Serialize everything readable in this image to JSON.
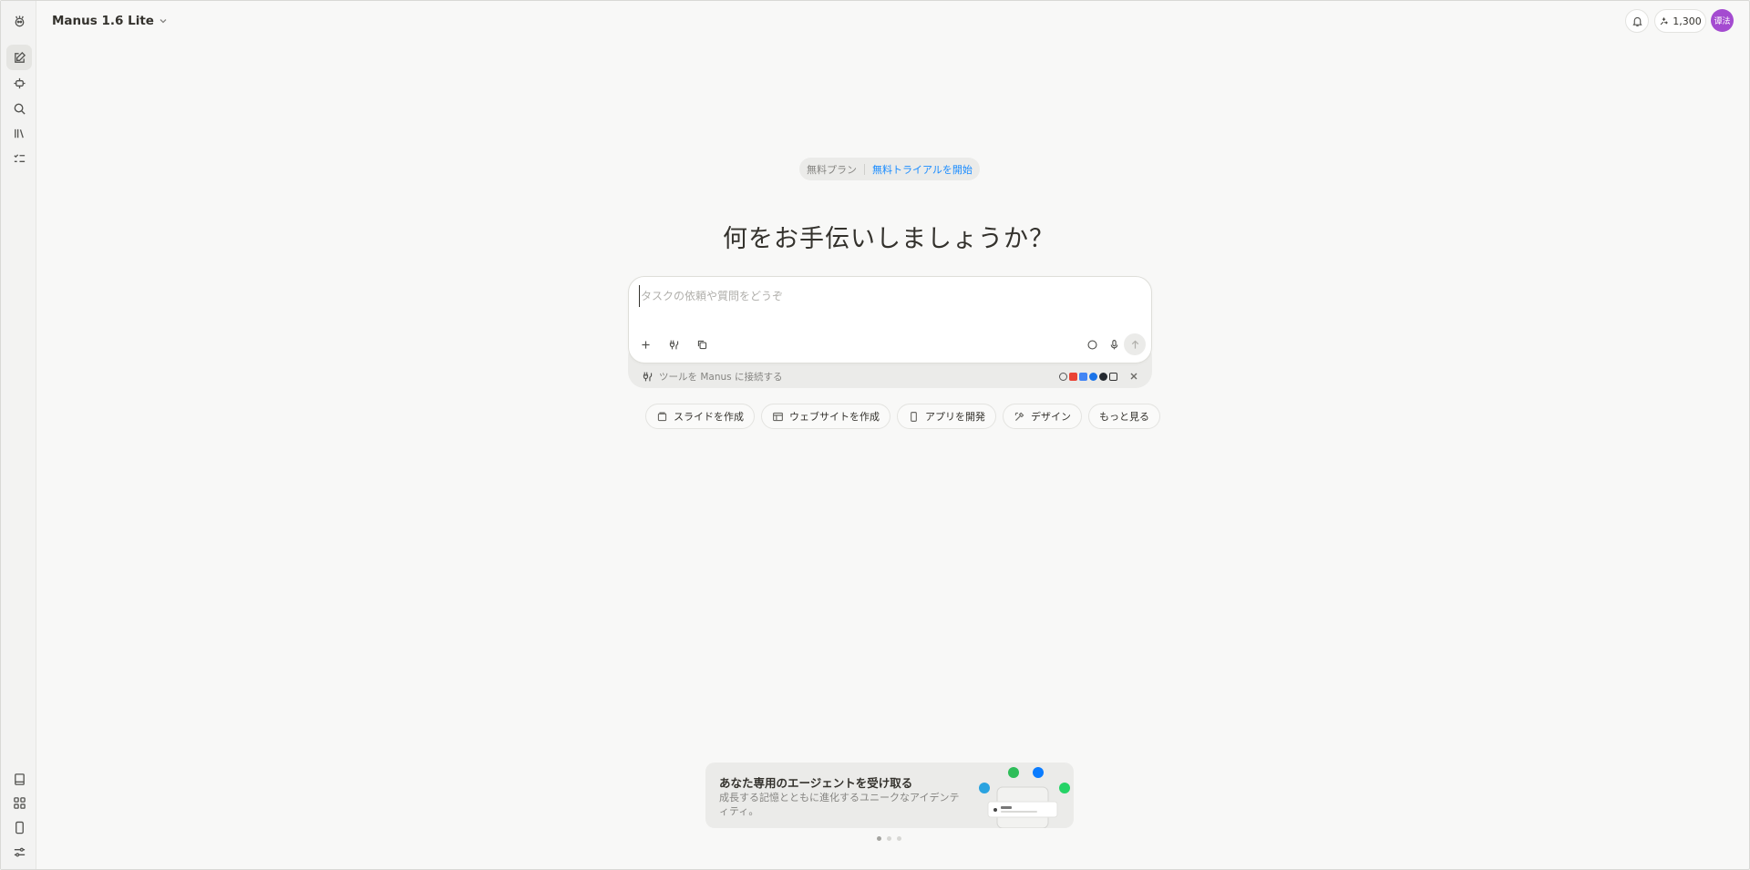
{
  "header": {
    "model_label": "Manus 1.6 Lite",
    "credits": "1,300",
    "avatar_initials": "谭法"
  },
  "sidebar": {
    "top_items": [
      {
        "name": "new-task",
        "icon": "edit-icon"
      },
      {
        "name": "agents",
        "icon": "agent-icon"
      },
      {
        "name": "search",
        "icon": "search-icon"
      },
      {
        "name": "library",
        "icon": "library-icon"
      },
      {
        "name": "tasks",
        "icon": "checklist-icon"
      }
    ],
    "bottom_items": [
      {
        "name": "docs",
        "icon": "book-icon"
      },
      {
        "name": "apps",
        "icon": "grid-icon"
      },
      {
        "name": "mobile",
        "icon": "phone-icon"
      },
      {
        "name": "settings",
        "icon": "sliders-icon"
      }
    ]
  },
  "plan": {
    "free_label": "無料プラン",
    "trial_label": "無料トライアルを開始"
  },
  "main": {
    "heading": "何をお手伝いしましょうか？",
    "input_placeholder": "タスクの依頼や質問をどうぞ",
    "connect_label": "ツールを Manus に接続する"
  },
  "quick_actions": [
    {
      "label": "スライドを作成",
      "icon": "slides-icon"
    },
    {
      "label": "ウェブサイトを作成",
      "icon": "website-icon"
    },
    {
      "label": "アプリを開発",
      "icon": "phone-icon"
    },
    {
      "label": "デザイン",
      "icon": "design-icon"
    },
    {
      "label": "もっと見る",
      "icon": ""
    }
  ],
  "promo": {
    "title": "あなた専用のエージェントを受け取る",
    "description": "成長する記憶とともに進化するユニークなアイデンティティ。"
  },
  "colors": {
    "accent": "#1a8cff",
    "avatar": "#a44bd0",
    "background": "#f8f8f7"
  }
}
